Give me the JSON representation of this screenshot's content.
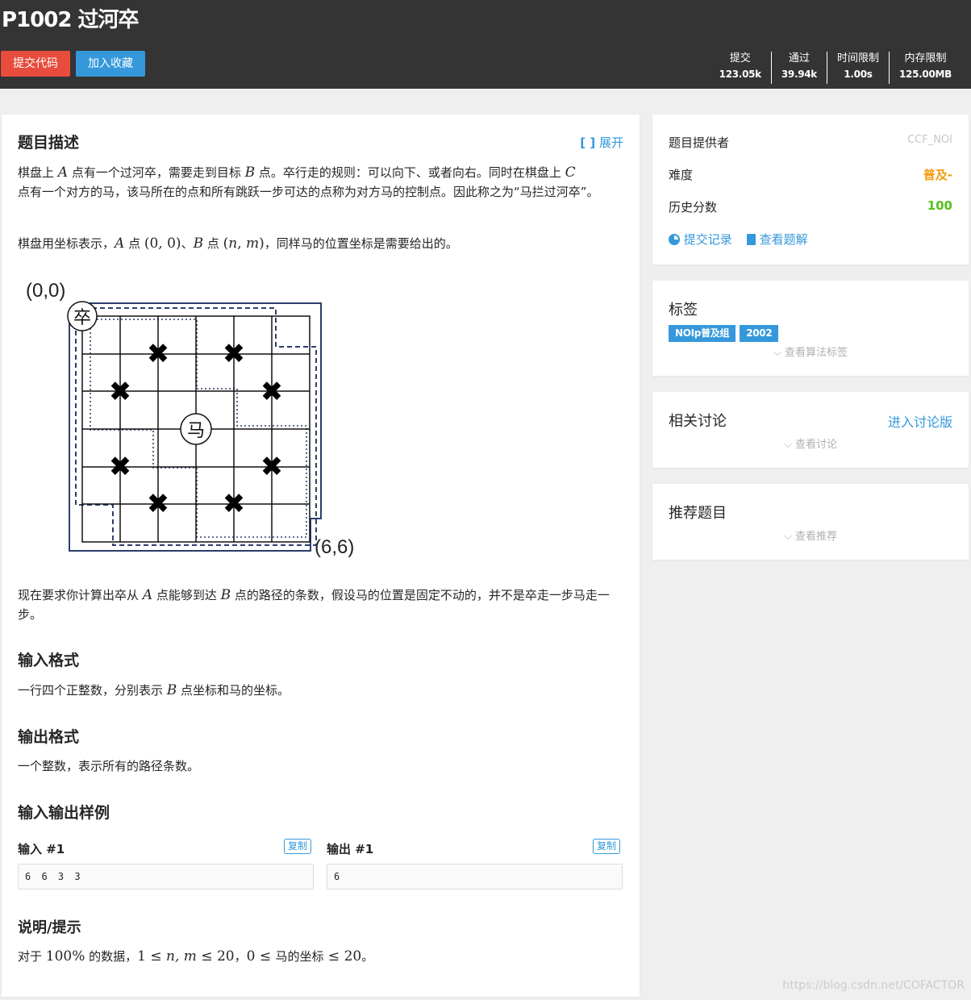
{
  "header": {
    "title": "P1002 过河卒",
    "submit_label": "提交代码",
    "favorite_label": "加入收藏",
    "stats": [
      {
        "label": "提交",
        "value": "123.05k"
      },
      {
        "label": "通过",
        "value": "39.94k"
      },
      {
        "label": "时间限制",
        "value": "1.00s"
      },
      {
        "label": "内存限制",
        "value": "125.00MB"
      }
    ]
  },
  "problem": {
    "desc_title": "题目描述",
    "expand_label": "展开",
    "desc_p1": {
      "a": "棋盘上 ",
      "A": "A",
      "b": " 点有一个过河卒，需要走到目标 ",
      "B": "B",
      "c": " 点。卒行走的规则：可以向下、或者向右。同时在棋盘上 ",
      "C": "C",
      "d": "点有一个对方的马，该马所在的点和所有跳跃一步可达的点称为对方马的控制点。因此称之为“马拦过河卒”。"
    },
    "desc_p2": {
      "a": "棋盘用坐标表示，",
      "A": "A",
      "b": " 点 ",
      "coordA": "(0, 0)",
      "c": "、",
      "B": "B",
      "d": " 点 ",
      "coordB_open": "(",
      "n": "n",
      "comma": ", ",
      "m": "m",
      "coordB_close": ")",
      "e": "，同样马的位置坐标是需要给出的。"
    },
    "figure": {
      "origin_label": "(0,0)",
      "end_label": "(6,6)",
      "pawn_char": "卒",
      "horse_char": "马"
    },
    "desc_p3": {
      "a": "现在要求你计算出卒从 ",
      "A": "A",
      "b": " 点能够到达 ",
      "B": "B",
      "c": " 点的路径的条数，假设马的位置是固定不动的，并不是卒走一步马走一步。"
    },
    "input_title": "输入格式",
    "input_desc": {
      "a": "一行四个正整数，分别表示 ",
      "B": "B",
      "b": " 点坐标和马的坐标。"
    },
    "output_title": "输出格式",
    "output_desc": "一个整数，表示所有的路径条数。",
    "samples_title": "输入输出样例",
    "input_label": "输入 #1",
    "output_label": "输出 #1",
    "copy_label": "复制",
    "sample_input": "6 6 3 3",
    "sample_output": "6",
    "hint_title": "说明/提示",
    "hint": {
      "a": "对于 ",
      "pct": "100%",
      "b": " 的数据，",
      "r1": "1 ≤ ",
      "nm": "n, m",
      "r2": " ≤ 20",
      "c": "，",
      "r3": "0 ≤ ",
      "d": "马的坐标",
      "r4": " ≤ 20",
      "e": "。"
    }
  },
  "info": {
    "provider_label": "题目提供者",
    "provider_value": "CCF_NOI",
    "difficulty_label": "难度",
    "difficulty_value": "普及-",
    "score_label": "历史分数",
    "score_value": "100",
    "submissions_link": "提交记录",
    "solutions_link": "查看题解"
  },
  "tags": {
    "title": "标签",
    "items": [
      "NOIp普及组",
      "2002"
    ],
    "more_label": "查看算法标签"
  },
  "discussion": {
    "title": "相关讨论",
    "enter_label": "进入讨论版",
    "more_label": "查看讨论"
  },
  "recommend": {
    "title": "推荐题目",
    "more_label": "查看推荐"
  },
  "watermark": "https://blog.csdn.net/COFACTOR",
  "colors": {
    "header_bg": "#343434",
    "red": "#e74c3c",
    "blue": "#3498db",
    "orange": "#f39c11",
    "green": "#52c41a"
  }
}
